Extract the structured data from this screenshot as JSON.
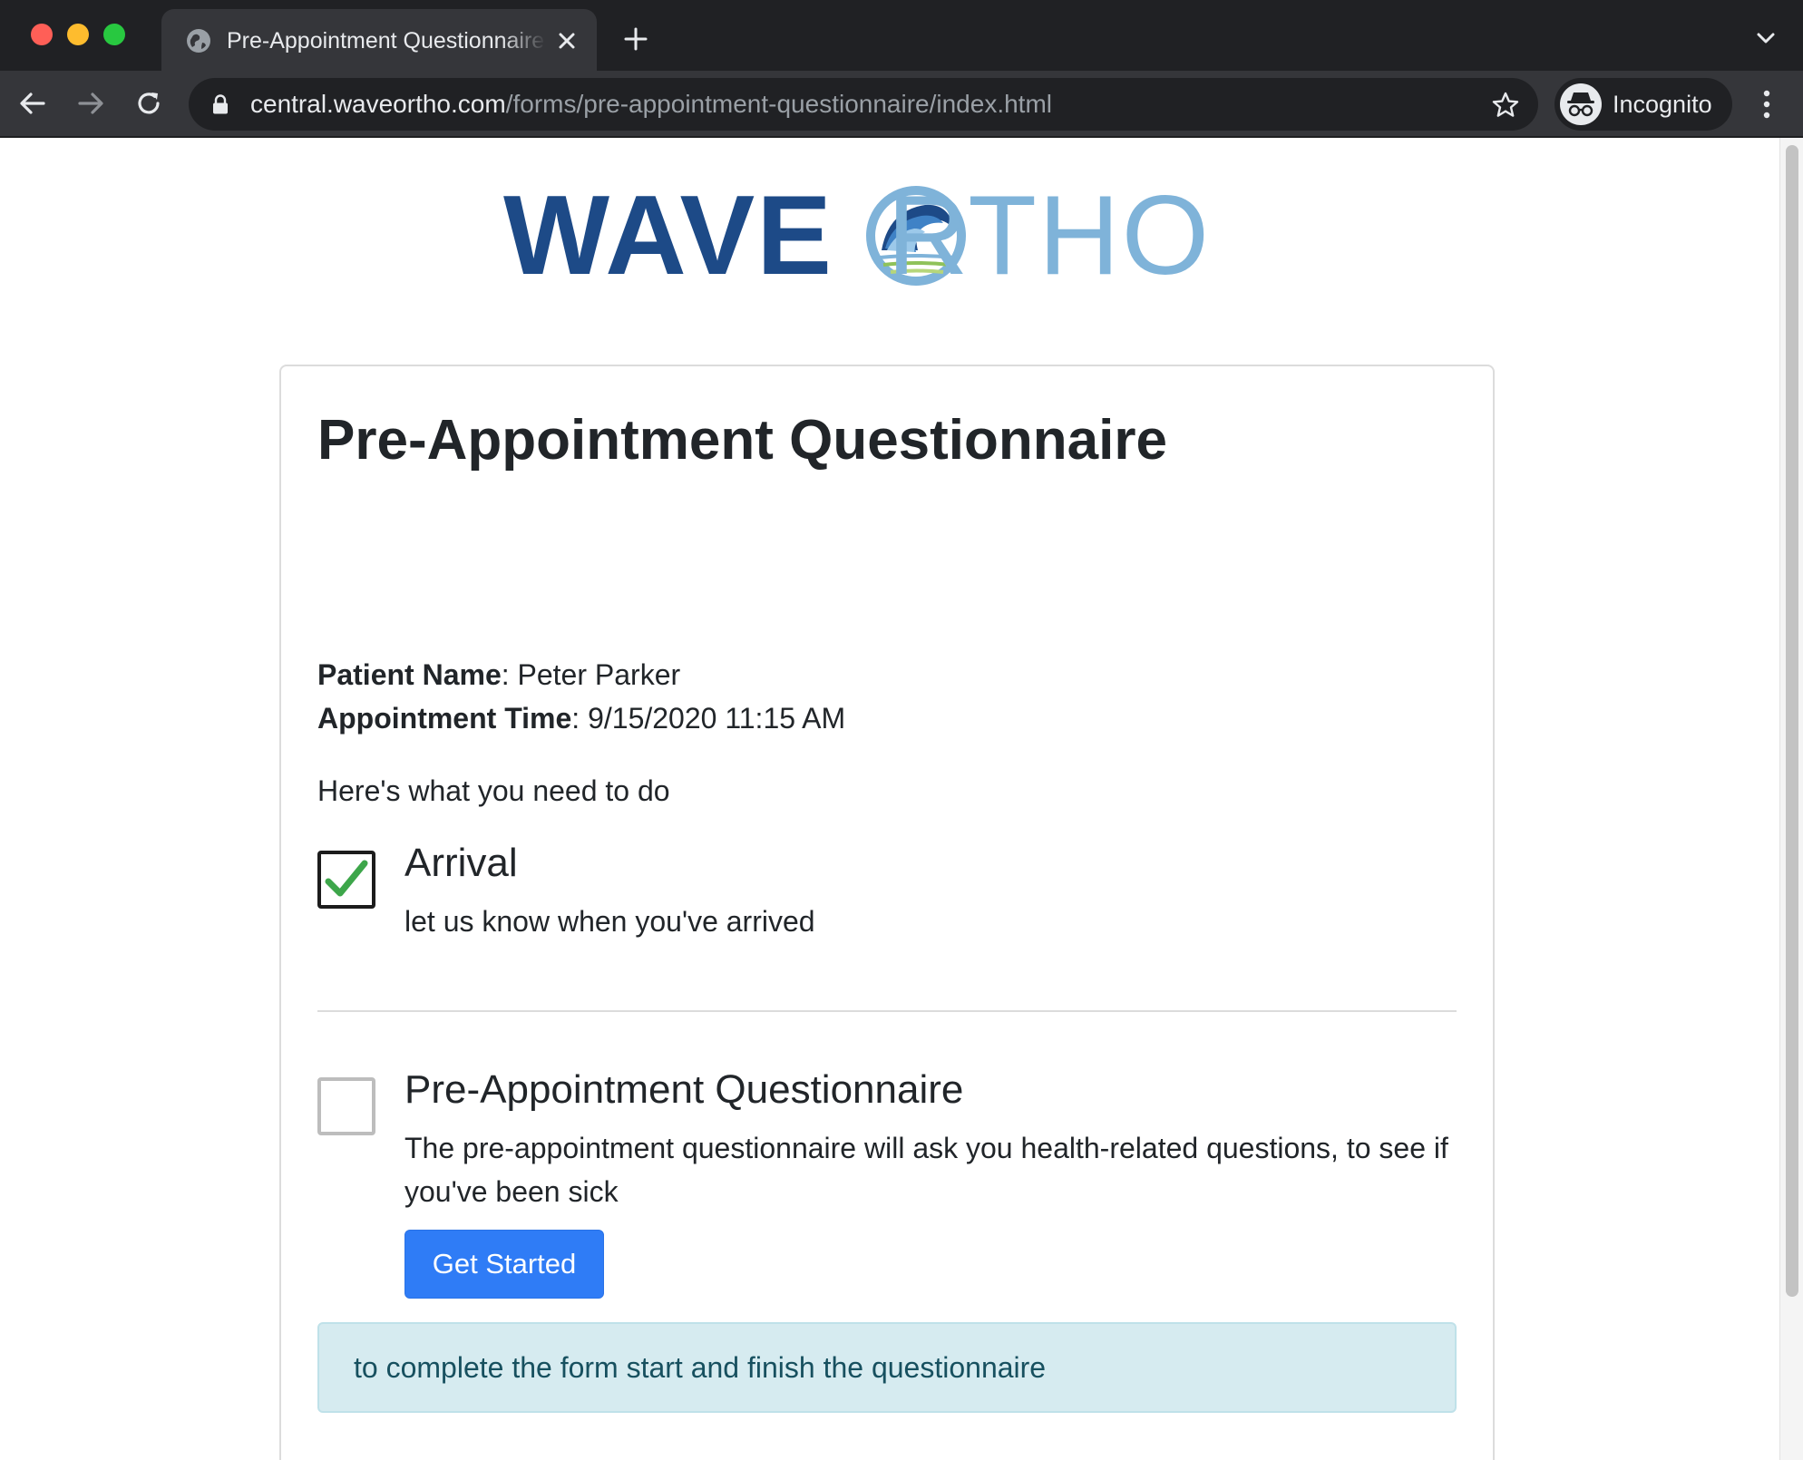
{
  "browser": {
    "tab_title": "Pre-Appointment Questionnaire",
    "url_host": "central.waveortho.com",
    "url_path": "/forms/pre-appointment-questionnaire/index.html",
    "profile_label": "Incognito"
  },
  "logo": {
    "part1": "WAVE",
    "part2": "RTHO",
    "colors": {
      "wave": "#1d4a87",
      "ortho": "#7fb3d9"
    }
  },
  "page": {
    "title": "Pre-Appointment Questionnaire",
    "patient_label": "Patient Name",
    "patient_value": ": Peter Parker",
    "appointment_label": "Appointment Time",
    "appointment_value": ": 9/15/2020 11:15 AM",
    "intro": "Here's what you need to do"
  },
  "tasks": [
    {
      "title": "Arrival",
      "description": "let us know when you've arrived",
      "checked": true
    },
    {
      "title": "Pre-Appointment Questionnaire",
      "description": "The pre-appointment questionnaire will ask you health-related questions, to see if you've been sick",
      "checked": false,
      "button_label": "Get Started"
    }
  ],
  "alert": {
    "text": "to complete the form start and finish the questionnaire"
  },
  "colors": {
    "primary_button": "#2f7cf6",
    "check_green": "#3da64a",
    "alert_bg": "#d6ebf0",
    "alert_text": "#17505f"
  }
}
